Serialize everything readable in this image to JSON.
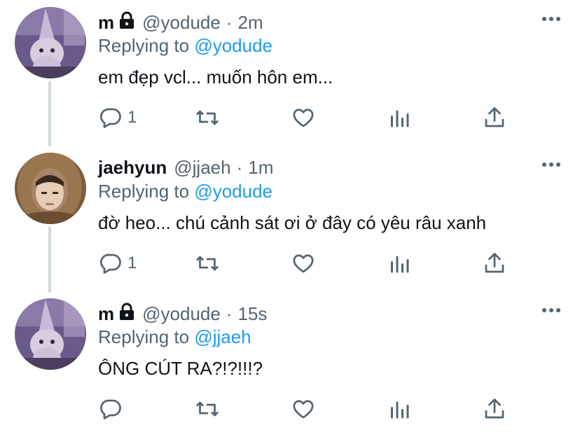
{
  "tweets": [
    {
      "name": "m",
      "handle": "@yodude",
      "separator": "·",
      "time": "2m",
      "reply_prefix": "Replying to",
      "reply_to": "@yodude",
      "text": "em đẹp vcl... muốn hôn em...",
      "reply_count": "1",
      "locked": true,
      "avatar": "fluffy-cat-with-pointed-hat-photo"
    },
    {
      "name": "jaehyun",
      "handle": "@jjaeh",
      "separator": "·",
      "time": "1m",
      "reply_prefix": "Replying to",
      "reply_to": "@yodude",
      "text": "đờ heo... chú cảnh sát ơi ở đây có yêu râu xanh",
      "reply_count": "1",
      "locked": false,
      "avatar": "person-in-brown-hood-photo"
    },
    {
      "name": "m",
      "handle": "@yodude",
      "separator": "·",
      "time": "15s",
      "reply_prefix": "Replying to",
      "reply_to": "@jjaeh",
      "text": "ÔNG CÚT RA?!?!!!?",
      "reply_count": "",
      "locked": true,
      "avatar": "fluffy-cat-with-pointed-hat-photo"
    }
  ],
  "colors": {
    "text": "#0f1419",
    "secondary": "#536471",
    "accent": "#1d9bf0",
    "thread_line": "#cfd9de"
  },
  "icons": [
    "reply-icon",
    "retweet-icon",
    "like-icon",
    "analytics-icon",
    "share-icon",
    "more-icon",
    "lock-icon"
  ]
}
